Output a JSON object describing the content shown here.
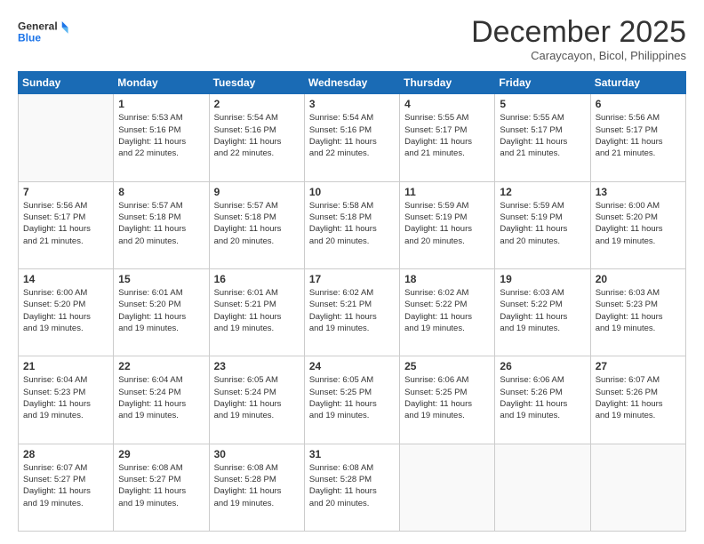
{
  "header": {
    "logo_line1": "General",
    "logo_line2": "Blue",
    "month": "December 2025",
    "location": "Caraycayon, Bicol, Philippines"
  },
  "days_of_week": [
    "Sunday",
    "Monday",
    "Tuesday",
    "Wednesday",
    "Thursday",
    "Friday",
    "Saturday"
  ],
  "weeks": [
    [
      {
        "day": "",
        "info": ""
      },
      {
        "day": "1",
        "info": "Sunrise: 5:53 AM\nSunset: 5:16 PM\nDaylight: 11 hours\nand 22 minutes."
      },
      {
        "day": "2",
        "info": "Sunrise: 5:54 AM\nSunset: 5:16 PM\nDaylight: 11 hours\nand 22 minutes."
      },
      {
        "day": "3",
        "info": "Sunrise: 5:54 AM\nSunset: 5:16 PM\nDaylight: 11 hours\nand 22 minutes."
      },
      {
        "day": "4",
        "info": "Sunrise: 5:55 AM\nSunset: 5:17 PM\nDaylight: 11 hours\nand 21 minutes."
      },
      {
        "day": "5",
        "info": "Sunrise: 5:55 AM\nSunset: 5:17 PM\nDaylight: 11 hours\nand 21 minutes."
      },
      {
        "day": "6",
        "info": "Sunrise: 5:56 AM\nSunset: 5:17 PM\nDaylight: 11 hours\nand 21 minutes."
      }
    ],
    [
      {
        "day": "7",
        "info": "Sunrise: 5:56 AM\nSunset: 5:17 PM\nDaylight: 11 hours\nand 21 minutes."
      },
      {
        "day": "8",
        "info": "Sunrise: 5:57 AM\nSunset: 5:18 PM\nDaylight: 11 hours\nand 20 minutes."
      },
      {
        "day": "9",
        "info": "Sunrise: 5:57 AM\nSunset: 5:18 PM\nDaylight: 11 hours\nand 20 minutes."
      },
      {
        "day": "10",
        "info": "Sunrise: 5:58 AM\nSunset: 5:18 PM\nDaylight: 11 hours\nand 20 minutes."
      },
      {
        "day": "11",
        "info": "Sunrise: 5:59 AM\nSunset: 5:19 PM\nDaylight: 11 hours\nand 20 minutes."
      },
      {
        "day": "12",
        "info": "Sunrise: 5:59 AM\nSunset: 5:19 PM\nDaylight: 11 hours\nand 20 minutes."
      },
      {
        "day": "13",
        "info": "Sunrise: 6:00 AM\nSunset: 5:20 PM\nDaylight: 11 hours\nand 19 minutes."
      }
    ],
    [
      {
        "day": "14",
        "info": "Sunrise: 6:00 AM\nSunset: 5:20 PM\nDaylight: 11 hours\nand 19 minutes."
      },
      {
        "day": "15",
        "info": "Sunrise: 6:01 AM\nSunset: 5:20 PM\nDaylight: 11 hours\nand 19 minutes."
      },
      {
        "day": "16",
        "info": "Sunrise: 6:01 AM\nSunset: 5:21 PM\nDaylight: 11 hours\nand 19 minutes."
      },
      {
        "day": "17",
        "info": "Sunrise: 6:02 AM\nSunset: 5:21 PM\nDaylight: 11 hours\nand 19 minutes."
      },
      {
        "day": "18",
        "info": "Sunrise: 6:02 AM\nSunset: 5:22 PM\nDaylight: 11 hours\nand 19 minutes."
      },
      {
        "day": "19",
        "info": "Sunrise: 6:03 AM\nSunset: 5:22 PM\nDaylight: 11 hours\nand 19 minutes."
      },
      {
        "day": "20",
        "info": "Sunrise: 6:03 AM\nSunset: 5:23 PM\nDaylight: 11 hours\nand 19 minutes."
      }
    ],
    [
      {
        "day": "21",
        "info": "Sunrise: 6:04 AM\nSunset: 5:23 PM\nDaylight: 11 hours\nand 19 minutes."
      },
      {
        "day": "22",
        "info": "Sunrise: 6:04 AM\nSunset: 5:24 PM\nDaylight: 11 hours\nand 19 minutes."
      },
      {
        "day": "23",
        "info": "Sunrise: 6:05 AM\nSunset: 5:24 PM\nDaylight: 11 hours\nand 19 minutes."
      },
      {
        "day": "24",
        "info": "Sunrise: 6:05 AM\nSunset: 5:25 PM\nDaylight: 11 hours\nand 19 minutes."
      },
      {
        "day": "25",
        "info": "Sunrise: 6:06 AM\nSunset: 5:25 PM\nDaylight: 11 hours\nand 19 minutes."
      },
      {
        "day": "26",
        "info": "Sunrise: 6:06 AM\nSunset: 5:26 PM\nDaylight: 11 hours\nand 19 minutes."
      },
      {
        "day": "27",
        "info": "Sunrise: 6:07 AM\nSunset: 5:26 PM\nDaylight: 11 hours\nand 19 minutes."
      }
    ],
    [
      {
        "day": "28",
        "info": "Sunrise: 6:07 AM\nSunset: 5:27 PM\nDaylight: 11 hours\nand 19 minutes."
      },
      {
        "day": "29",
        "info": "Sunrise: 6:08 AM\nSunset: 5:27 PM\nDaylight: 11 hours\nand 19 minutes."
      },
      {
        "day": "30",
        "info": "Sunrise: 6:08 AM\nSunset: 5:28 PM\nDaylight: 11 hours\nand 19 minutes."
      },
      {
        "day": "31",
        "info": "Sunrise: 6:08 AM\nSunset: 5:28 PM\nDaylight: 11 hours\nand 20 minutes."
      },
      {
        "day": "",
        "info": ""
      },
      {
        "day": "",
        "info": ""
      },
      {
        "day": "",
        "info": ""
      }
    ]
  ]
}
